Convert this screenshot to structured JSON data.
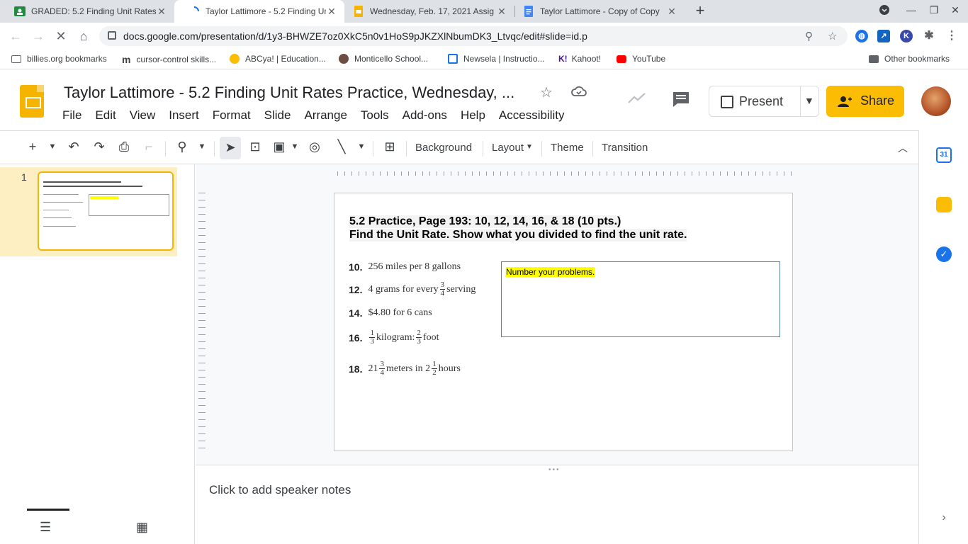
{
  "browser": {
    "tabs": [
      {
        "title": "GRADED: 5.2 Finding Unit Rates",
        "close": "✕"
      },
      {
        "title": "Taylor Lattimore - 5.2 Finding Un",
        "close": "✕"
      },
      {
        "title": "Wednesday, Feb. 17, 2021 Assig",
        "close": "✕"
      },
      {
        "title": "Taylor Lattimore - Copy of Copy",
        "close": "✕"
      }
    ],
    "new_tab": "+",
    "url": "docs.google.com/presentation/d/1y3-BHWZE7oz0XkC5n0v1HoS9pJKZXlNbumDK3_Ltvqc/edit#slide=id.p",
    "bookmarks": [
      "billies.org bookmarks",
      "cursor-control skills...",
      "ABCya! | Education...",
      "Monticello School...",
      "Newsela | Instructio...",
      "Kahoot!",
      "YouTube"
    ],
    "other_bookmarks": "Other bookmarks",
    "colors": {
      "tabstrip": "#dee1e6",
      "omnibox": "#f1f3f4"
    }
  },
  "app": {
    "title": "Taylor Lattimore - 5.2 Finding Unit Rates Practice, Wednesday, ...",
    "menu": [
      "File",
      "Edit",
      "View",
      "Insert",
      "Format",
      "Slide",
      "Arrange",
      "Tools",
      "Add-ons",
      "Help",
      "Accessibility"
    ],
    "present_label": "Present",
    "share_label": "Share",
    "toolbar_text": {
      "background": "Background",
      "layout": "Layout",
      "theme": "Theme",
      "transition": "Transition"
    },
    "colors": {
      "brand": "#f4b400",
      "share": "#fbbc04",
      "selected_slide": "#feefc3"
    }
  },
  "filmstrip": {
    "slide_number": "1"
  },
  "slide": {
    "heading1": "5.2 Practice, Page 193: 10, 12, 14, 16, & 18 (10 pts.)",
    "heading2": "Find the Unit Rate.  Show what you divided to find the unit rate.",
    "problems": [
      {
        "num": "10.",
        "text": "256 miles per 8 gallons"
      },
      {
        "num": "12.",
        "pre": "4 grams for every",
        "frac_n": "3",
        "frac_d": "4",
        "post": "serving"
      },
      {
        "num": "14.",
        "text": "$4.80 for 6 cans"
      },
      {
        "num": "16.",
        "f1n": "1",
        "f1d": "3",
        "mid": "kilogram:",
        "f2n": "2",
        "f2d": "3",
        "post": "foot"
      },
      {
        "num": "18.",
        "w1": "21",
        "f1n": "3",
        "f1d": "4",
        "mid": "meters in 2",
        "f2n": "1",
        "f2d": "2",
        "post": "hours"
      }
    ],
    "answer_box": "Number your problems."
  },
  "notes": {
    "placeholder": "Click to add speaker notes"
  }
}
